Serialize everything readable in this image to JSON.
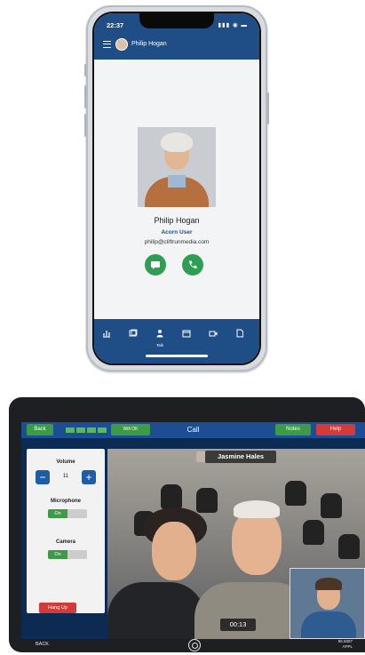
{
  "phone": {
    "status_time": "22:37",
    "header_title": "Philip Hogan",
    "contact_name": "Philip Hogan",
    "contact_role": "Acorn User",
    "contact_email": "philip@cliftrunmedia.com",
    "tabs": [
      {
        "icon": "chart-icon",
        "label": ""
      },
      {
        "icon": "gallery-icon",
        "label": ""
      },
      {
        "icon": "person-icon",
        "label": "Talk"
      },
      {
        "icon": "calendar-icon",
        "label": ""
      },
      {
        "icon": "video-icon",
        "label": ""
      },
      {
        "icon": "document-icon",
        "label": ""
      }
    ],
    "colors": {
      "header": "#1f4e86",
      "action": "#2e9e55"
    }
  },
  "tablet": {
    "back_label": "Back",
    "signal_label": "Wifi OK",
    "title": "Call",
    "notes_label": "Notes",
    "help_label": "Help",
    "volume_label": "Volume",
    "volume_value": "11",
    "microphone_label": "Microphone",
    "microphone_state": "On",
    "camera_label": "Camera",
    "camera_state": "On",
    "hangup_label": "Hang Up",
    "remote_name": "Jasmine Hales",
    "call_duration": "00:13",
    "bottom_back": "BACK",
    "network_line1": "86.5087",
    "network_line2": "APPL",
    "colors": {
      "topbar": "#1c4e93",
      "back": "#3d9a45",
      "notes": "#3d9a45",
      "help": "#d33a3a",
      "hangup": "#d33a3a"
    }
  }
}
